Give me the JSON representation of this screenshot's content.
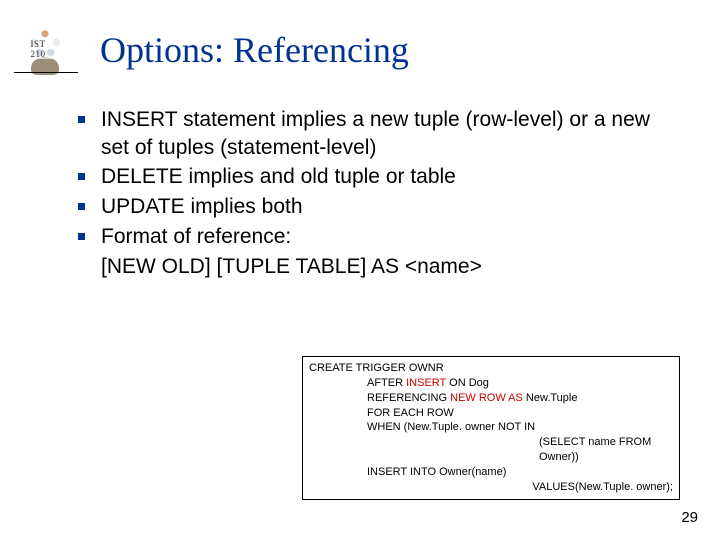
{
  "logo_label": "IST 210",
  "title": "Options: Referencing",
  "bullets": [
    "INSERT statement implies a new tuple (row-level) or a new set of tuples (statement-level)",
    "DELETE implies and old tuple or table",
    "UPDATE implies both",
    "Format of reference:"
  ],
  "bullet_tail": "[NEW OLD] [TUPLE TABLE] AS <name>",
  "code": {
    "l1": "CREATE TRIGGER OWNR",
    "l2a_pre": "AFTER ",
    "l2a_red": "INSERT",
    "l2a_post": " ON Dog",
    "l2b_pre": "REFERENCING ",
    "l2b_red": "NEW ROW AS",
    "l2b_post": " New.Tuple",
    "l2c": "FOR EACH ROW",
    "l2d": "WHEN (New.Tuple. owner NOT IN",
    "l3": "(SELECT name FROM Owner))",
    "l2e": "INSERT INTO Owner(name)",
    "rt": "VALUES(New.Tuple. owner);"
  },
  "page_number": "29"
}
